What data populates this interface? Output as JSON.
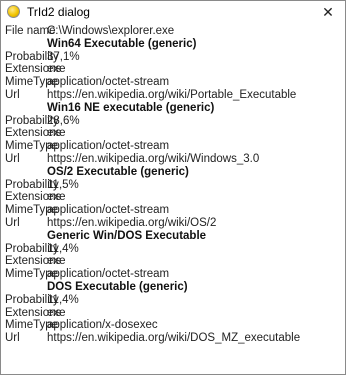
{
  "window": {
    "title": "TrId2 dialog",
    "close_glyph": "✕",
    "icon": "app-icon"
  },
  "file": {
    "label": "File name",
    "value": "C:\\Windows\\explorer.exe"
  },
  "results": [
    {
      "name": "Win64 Executable (generic)",
      "fields": [
        {
          "label": "Probability",
          "value": "37,1%"
        },
        {
          "label": "Extensions",
          "value": "exe"
        },
        {
          "label": "MimeType",
          "value": "application/octet-stream"
        },
        {
          "label": "Url",
          "value": "https://en.wikipedia.org/wiki/Portable_Executable"
        }
      ]
    },
    {
      "name": "Win16 NE executable (generic)",
      "fields": [
        {
          "label": "Probability",
          "value": "28,6%"
        },
        {
          "label": "Extensions",
          "value": "exe"
        },
        {
          "label": "MimeType",
          "value": "application/octet-stream"
        },
        {
          "label": "Url",
          "value": "https://en.wikipedia.org/wiki/Windows_3.0"
        }
      ]
    },
    {
      "name": "OS/2 Executable (generic)",
      "fields": [
        {
          "label": "Probability",
          "value": "11,5%"
        },
        {
          "label": "Extensions",
          "value": "exe"
        },
        {
          "label": "MimeType",
          "value": "application/octet-stream"
        },
        {
          "label": "Url",
          "value": "https://en.wikipedia.org/wiki/OS/2"
        }
      ]
    },
    {
      "name": "Generic Win/DOS Executable",
      "fields": [
        {
          "label": "Probability",
          "value": "11,4%"
        },
        {
          "label": "Extensions",
          "value": "exe"
        },
        {
          "label": "MimeType",
          "value": "application/octet-stream"
        }
      ]
    },
    {
      "name": "DOS Executable (generic)",
      "fields": [
        {
          "label": "Probability",
          "value": "11,4%"
        },
        {
          "label": "Extensions",
          "value": "exe"
        },
        {
          "label": "MimeType",
          "value": "application/x-dosexec"
        },
        {
          "label": "Url",
          "value": "https://en.wikipedia.org/wiki/DOS_MZ_executable"
        }
      ]
    }
  ]
}
